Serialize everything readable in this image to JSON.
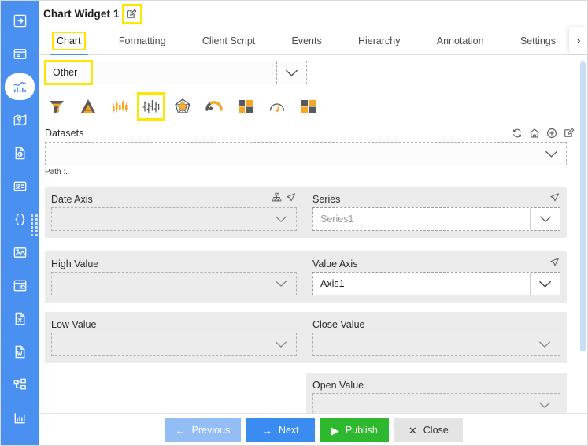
{
  "sidebar": {
    "items": [
      {
        "name": "logout-arrow-icon",
        "icon": "arrow-right-box"
      },
      {
        "name": "window-card-icon",
        "icon": "window"
      },
      {
        "name": "chart-widget-icon",
        "icon": "chart-line",
        "active": true
      },
      {
        "name": "map-widget-icon",
        "icon": "map-pin"
      },
      {
        "name": "document-refresh-icon",
        "icon": "doc-refresh"
      },
      {
        "name": "id-card-icon",
        "icon": "id-card"
      },
      {
        "name": "code-braces-icon",
        "icon": "braces"
      },
      {
        "name": "image-chart-icon",
        "icon": "image-chart"
      },
      {
        "name": "calendar-table-icon",
        "icon": "calendar"
      },
      {
        "name": "excel-document-icon",
        "icon": "doc-x"
      },
      {
        "name": "word-document-icon",
        "icon": "doc-w"
      },
      {
        "name": "hierarchy-tree-icon",
        "icon": "tree"
      },
      {
        "name": "bar-chart-icon",
        "icon": "bar-chart"
      }
    ]
  },
  "header": {
    "title": "Chart Widget 1",
    "edit_icon": "pencil-square-icon"
  },
  "tabs": [
    {
      "label": "Chart",
      "active": true
    },
    {
      "label": "Formatting",
      "active": false
    },
    {
      "label": "Client Script",
      "active": false
    },
    {
      "label": "Events",
      "active": false
    },
    {
      "label": "Hierarchy",
      "active": false
    },
    {
      "label": "Annotation",
      "active": false
    },
    {
      "label": "Settings",
      "active": false
    }
  ],
  "tab_overflow": {
    "icon": "chevron-right-icon",
    "glyph": "›"
  },
  "chart_type": {
    "selected": "Other",
    "placeholder": "",
    "dropdown_icon": "chevron-down-icon",
    "icons": [
      {
        "name": "funnel-chart-icon",
        "selected": false
      },
      {
        "name": "pyramid-chart-icon",
        "selected": false
      },
      {
        "name": "candlestick-chart-icon",
        "selected": false
      },
      {
        "name": "ohlc-chart-icon",
        "selected": true
      },
      {
        "name": "radar-chart-icon",
        "selected": false
      },
      {
        "name": "semi-gauge-chart-icon",
        "selected": false
      },
      {
        "name": "treemap-chart-icon",
        "selected": false
      },
      {
        "name": "gauge-chart-icon",
        "selected": false
      },
      {
        "name": "tile-chart-icon",
        "selected": false
      }
    ]
  },
  "datasets": {
    "label": "Datasets",
    "value": "",
    "placeholder": "",
    "path_text": "Path :.",
    "toolbar": [
      {
        "name": "refresh-icon"
      },
      {
        "name": "home-icon"
      },
      {
        "name": "add-circle-icon"
      },
      {
        "name": "edit-icon"
      }
    ]
  },
  "fields": {
    "date_axis": {
      "label": "Date Axis",
      "value": "",
      "placeholder": "",
      "icons": [
        "hierarchy-icon",
        "send-arrow-icon"
      ]
    },
    "series": {
      "label": "Series",
      "value": "",
      "placeholder": "Series1",
      "icons": [
        "send-arrow-icon"
      ]
    },
    "high_value": {
      "label": "High Value",
      "value": "",
      "placeholder": "",
      "icons": []
    },
    "value_axis": {
      "label": "Value Axis",
      "value": "Axis1",
      "placeholder": "",
      "icons": [
        "send-arrow-icon"
      ]
    },
    "low_value": {
      "label": "Low Value",
      "value": "",
      "placeholder": "",
      "icons": []
    },
    "close_value": {
      "label": "Close Value",
      "value": "",
      "placeholder": "",
      "icons": []
    },
    "open_value": {
      "label": "Open Value",
      "value": "",
      "placeholder": "",
      "icons": []
    }
  },
  "footer": {
    "previous": {
      "label": "Previous",
      "glyph": "←"
    },
    "next": {
      "label": "Next",
      "glyph": "→"
    },
    "publish": {
      "label": "Publish",
      "glyph": "▶"
    },
    "close": {
      "label": "Close",
      "glyph": "✕"
    }
  },
  "colors": {
    "sidebar": "#4a90f0",
    "accent": "#3b8cf0",
    "highlight": "#ffe600",
    "publish": "#2eb82e",
    "chart_icon_orange": "#f5a623",
    "chart_icon_grey": "#58595b"
  }
}
